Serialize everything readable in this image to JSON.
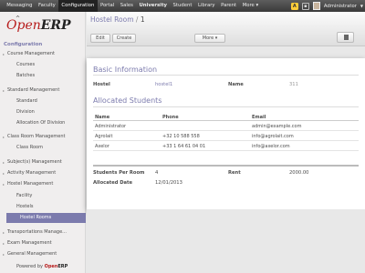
{
  "topbar": {
    "menu": [
      "Messaging",
      "Faculty",
      "Configuration",
      "Portal",
      "Sales",
      "University",
      "Student",
      "Library",
      "Parent",
      "More ▾"
    ],
    "active_index": 2,
    "bold_index": 5,
    "notify_label": "A",
    "user": "Administrator"
  },
  "sidebar": {
    "logo_open": "Open",
    "logo_erp": "ERP",
    "section": "Configuration",
    "items": [
      {
        "label": "Course Management",
        "kind": "top"
      },
      {
        "label": "Courses",
        "kind": "sub"
      },
      {
        "label": "Batches",
        "kind": "sub"
      },
      {
        "label": "Standard Management",
        "kind": "top"
      },
      {
        "label": "Standard",
        "kind": "sub"
      },
      {
        "label": "Division",
        "kind": "sub"
      },
      {
        "label": "Allocation Of Division",
        "kind": "sub"
      },
      {
        "label": "Class Room Management",
        "kind": "top"
      },
      {
        "label": "Class Room",
        "kind": "sub"
      },
      {
        "label": "Subject(s) Management",
        "kind": "top"
      },
      {
        "label": "Activity Management",
        "kind": "top"
      },
      {
        "label": "Hostel Management",
        "kind": "top"
      },
      {
        "label": "Facility",
        "kind": "sub"
      },
      {
        "label": "Hostels",
        "kind": "sub"
      },
      {
        "label": "Hostel Rooms",
        "kind": "selected"
      },
      {
        "label": "Transportations Manage...",
        "kind": "top"
      },
      {
        "label": "Exam Management",
        "kind": "top"
      },
      {
        "label": "General Management",
        "kind": "top"
      }
    ],
    "powered_prefix": "Powered by",
    "powered_open": "Open",
    "powered_erp": "ERP"
  },
  "header": {
    "breadcrumb_link": "Hostel Room",
    "breadcrumb_sep": "/",
    "breadcrumb_current": "1",
    "edit_label": "Edit",
    "create_label": "Create",
    "more_label": "More ▾"
  },
  "form": {
    "basic_title": "Basic Information",
    "hostel_label": "Hostel",
    "hostel_value": "hostel1",
    "name_label": "Name",
    "name_value": "311",
    "students_title": "Allocated Students",
    "columns": [
      "Name",
      "Phone",
      "Email"
    ],
    "rows": [
      [
        "Administrator",
        "",
        "admin@example.com"
      ],
      [
        "Agrolait",
        "+32 10 588 558",
        "info@agrolait.com"
      ],
      [
        "Axelor",
        "+33 1 64 61 04 01",
        "info@axelor.com"
      ]
    ],
    "students_per_room_label": "Students Per Room",
    "students_per_room_value": "4",
    "rent_label": "Rent",
    "rent_value": "2000.00",
    "allocated_date_label": "Allocated Date",
    "allocated_date_value": "12/01/2013"
  }
}
